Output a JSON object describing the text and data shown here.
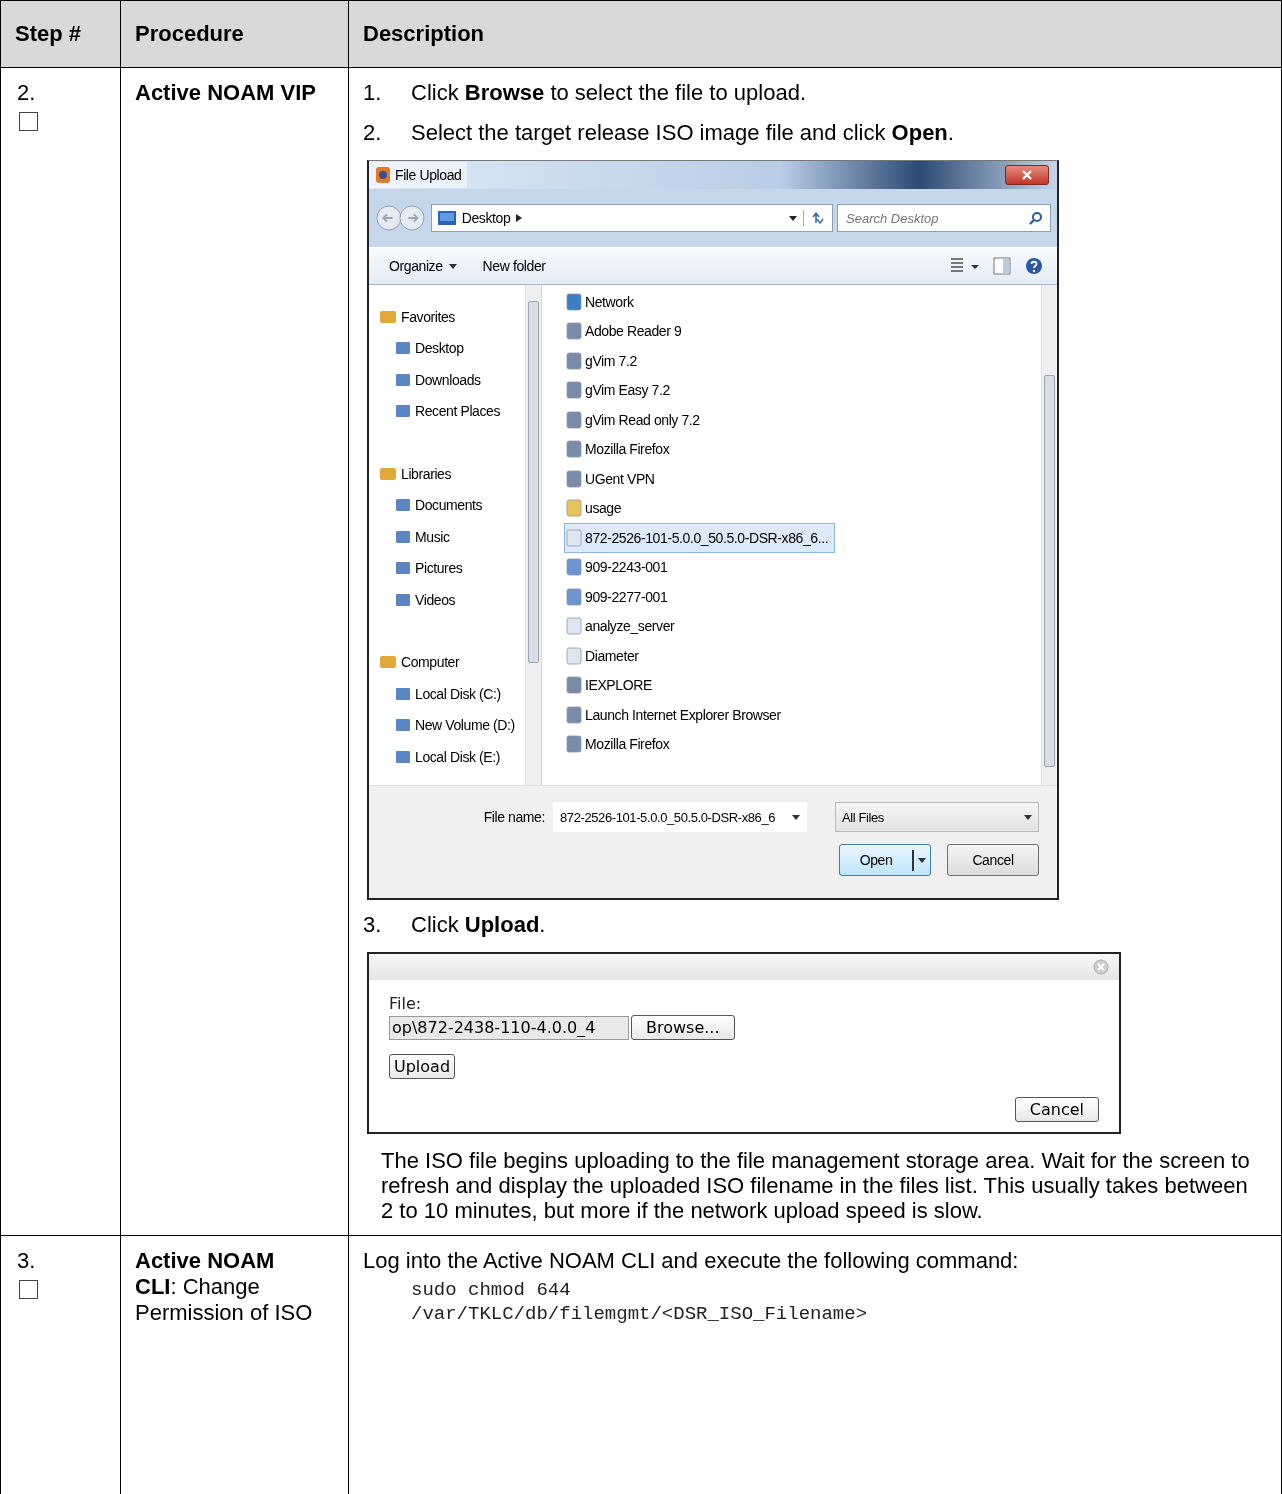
{
  "table": {
    "columns": [
      "Step #",
      "Procedure",
      "Description"
    ],
    "rows": [
      {
        "step": "2.",
        "checked": false,
        "procedure": "Active NOAM VIP",
        "blocks": [
          {
            "kind": "step",
            "number": "1.",
            "text": "Click **Browse** to select the file to upload."
          },
          {
            "kind": "step",
            "number": "2.",
            "text": "Select the target release ISO image file and click **Open**."
          },
          {
            "kind": "file_dialog",
            "title": "File Upload",
            "breadcrumb": "Desktop",
            "search_placeholder": "Search Desktop",
            "toolbar": [
              "Organize",
              "New folder"
            ],
            "nav": [
              {
                "label": "Favorites",
                "children": [
                  {
                    "label": "Desktop"
                  },
                  {
                    "label": "Downloads"
                  },
                  {
                    "label": "Recent Places"
                  }
                ]
              },
              {
                "label": "Libraries",
                "children": [
                  {
                    "label": "Documents"
                  },
                  {
                    "label": "Music"
                  },
                  {
                    "label": "Pictures"
                  },
                  {
                    "label": "Videos"
                  }
                ]
              },
              {
                "label": "Computer",
                "children": [
                  {
                    "label": "Local Disk (C:)"
                  },
                  {
                    "label": "New Volume (D:)"
                  },
                  {
                    "label": "Local Disk (E:)"
                  }
                ]
              }
            ],
            "files": [
              {
                "name": "Network",
                "kind": "network",
                "selected": false
              },
              {
                "name": "Adobe Reader 9",
                "kind": "app",
                "selected": false
              },
              {
                "name": "gVim 7.2",
                "kind": "app",
                "selected": false
              },
              {
                "name": "gVim Easy 7.2",
                "kind": "app",
                "selected": false
              },
              {
                "name": "gVim Read only 7.2",
                "kind": "app",
                "selected": false
              },
              {
                "name": "Mozilla Firefox",
                "kind": "app",
                "selected": false
              },
              {
                "name": "UGent VPN",
                "kind": "app",
                "selected": false
              },
              {
                "name": "usage",
                "kind": "folder",
                "selected": false
              },
              {
                "name": "872-2526-101-5.0.0_50.5.0-DSR-x86_6...",
                "kind": "file",
                "selected": true
              },
              {
                "name": "909-2243-001",
                "kind": "document",
                "selected": false
              },
              {
                "name": "909-2277-001",
                "kind": "document",
                "selected": false
              },
              {
                "name": "analyze_server",
                "kind": "file",
                "selected": false
              },
              {
                "name": "Diameter",
                "kind": "file",
                "selected": false
              },
              {
                "name": "IEXPLORE",
                "kind": "app",
                "selected": false
              },
              {
                "name": "Launch Internet Explorer Browser",
                "kind": "app",
                "selected": false
              },
              {
                "name": "Mozilla Firefox",
                "kind": "app",
                "selected": false
              }
            ],
            "file_name_label": "File name:",
            "file_name": "872-2526-101-5.0.0_50.5.0-DSR-x86_6",
            "file_type": "All Files",
            "open": "Open",
            "cancel": "Cancel"
          },
          {
            "kind": "step",
            "number": "3.",
            "text": "Click **Upload**."
          },
          {
            "kind": "upload_dialog",
            "file_label": "File:",
            "file_value": "op\\872-2438-110-4.0.0_4",
            "browse": "Browse...",
            "upload": "Upload",
            "cancel": "Cancel"
          },
          {
            "kind": "paragraph",
            "text": "The ISO file begins uploading to the file management storage area. Wait for the screen to refresh and display the uploaded ISO filename in the files list.  This usually takes between 2 to 10 minutes, but more if the network upload speed is slow."
          }
        ]
      },
      {
        "step": "3.",
        "checked": false,
        "procedure": "**Active NOAM CLI**: Change Permission of ISO",
        "blocks": [
          {
            "kind": "text",
            "text": "Log into the Active NOAM CLI and execute the following command:"
          },
          {
            "kind": "code",
            "lines": [
              "sudo chmod 644",
              "/var/TKLC/db/filemgmt/<DSR_ISO_Filename>"
            ]
          }
        ]
      }
    ]
  }
}
